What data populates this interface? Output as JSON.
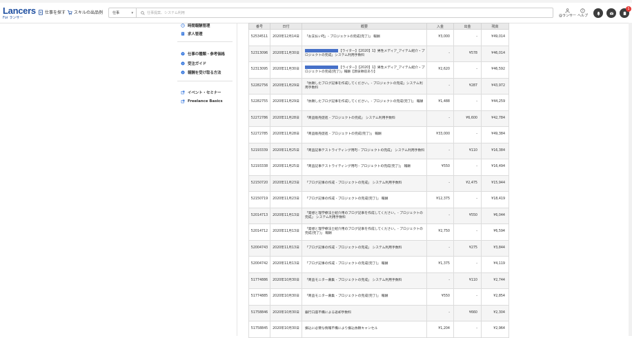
{
  "header": {
    "logo": "Lancers",
    "logo_sub": "For ランサー",
    "nav_find_jobs": "仕事を探す",
    "nav_skill_listing": "スキルの出品例",
    "category_select": "仕事",
    "search_placeholder": "仕事提案、システム利用",
    "menu_lancer": "@ランサー",
    "menu_help": "ヘルプ",
    "notification_badge": "1"
  },
  "sidebar": {
    "items": [
      {
        "label": "時間報酬管理"
      },
      {
        "label": "求人管理"
      },
      {
        "label": "仕事の種類・参考価格"
      },
      {
        "label": "受注ガイド"
      },
      {
        "label": "報酬を受け取る方法"
      },
      {
        "label": "イベント・セミナー"
      },
      {
        "label": "Freelance Basics"
      }
    ]
  },
  "table": {
    "headers": [
      "番号",
      "日付",
      "概要",
      "入金",
      "出金",
      "残高"
    ],
    "rows": [
      {
        "id": "52534511",
        "date": "2020年12月14日",
        "desc": "「お支払いPJ」- プロジェクトの完成(完了)」 報酬",
        "in": "¥3,000",
        "out": "-",
        "bal": "¥49,014",
        "redact": false
      },
      {
        "id": "52313096",
        "date": "2020年11月30日",
        "desc": "【ライター】【2020】1】男性メディア_アイテム紹介・プロジェクトの完成」システム利用手数料",
        "in": "-",
        "out": "¥578",
        "bal": "¥46,014",
        "redact": true
      },
      {
        "id": "52313095",
        "date": "2020年11月30日",
        "desc": "【ライター】【2020】1】男性メディア_アイテム紹介・プロジェクトの完成(完了)」報酬【源泉徴収あり】",
        "in": "¥2,620",
        "out": "-",
        "bal": "¥46,592",
        "redact": true
      },
      {
        "id": "52282756",
        "date": "2020年11月29日",
        "desc": "「依頼したブログ記事を作成してください。- プロジェクトの完成」システム利用手数料",
        "in": "-",
        "out": "¥287",
        "bal": "¥43,972",
        "redact": false
      },
      {
        "id": "52282755",
        "date": "2020年11月29日",
        "desc": "「依頼したブログ記事を作成してください。- プロジェクトの完成(完了)」 報酬",
        "in": "¥1,488",
        "out": "-",
        "bal": "¥44,259",
        "redact": false
      },
      {
        "id": "52272786",
        "date": "2020年11月28日",
        "desc": "「商品販売促進 - プロジェクトの完成」 システム利用手数料",
        "in": "-",
        "out": "¥6,600",
        "bal": "¥42,784",
        "redact": false
      },
      {
        "id": "52272785",
        "date": "2020年11月28日",
        "desc": "「商品販売促進 - プロジェクトの完成(完了)」 報酬",
        "in": "¥33,000",
        "out": "-",
        "bal": "¥49,384",
        "redact": false
      },
      {
        "id": "52193339",
        "date": "2020年11月25日",
        "desc": "「商品記事テストライティング用PJ - プロジェクトの完成」 システム利用手数料",
        "in": "-",
        "out": "¥110",
        "bal": "¥16,384",
        "redact": false
      },
      {
        "id": "52193338",
        "date": "2020年11月25日",
        "desc": "「商品記事テストライティング用PJ - プロジェクトの完成(完了)」 報酬",
        "in": "¥550",
        "out": "-",
        "bal": "¥16,494",
        "redact": false
      },
      {
        "id": "52150720",
        "date": "2020年11月23日",
        "desc": "「ブログ記事の作成 - プロジェクトの完成」 システム利用手数料",
        "in": "-",
        "out": "¥2,475",
        "bal": "¥15,944",
        "redact": false
      },
      {
        "id": "52150719",
        "date": "2020年11月23日",
        "desc": "「ブログ記事の作成 - プロジェクトの完成(完了)」 報酬",
        "in": "¥12,375",
        "out": "-",
        "bal": "¥18,419",
        "redact": false
      },
      {
        "id": "52014713",
        "date": "2020年11月13日",
        "desc": "「発想と理学療法士紹介用のブログ記事を作成してください。- プロジェクトの完成」 システム利用手数料",
        "in": "-",
        "out": "¥550",
        "bal": "¥6,044",
        "redact": false
      },
      {
        "id": "52014712",
        "date": "2020年11月13日",
        "desc": "「発想と理学療法士紹介用のブログ記事を作成してください。- プロジェクトの完成(完了)」 報酬",
        "in": "¥2,750",
        "out": "-",
        "bal": "¥6,594",
        "redact": false
      },
      {
        "id": "52004743",
        "date": "2020年11月13日",
        "desc": "「ブログ記事の作成 - プロジェクトの完成」 システム利用手数料",
        "in": "-",
        "out": "¥275",
        "bal": "¥3,844",
        "redact": false
      },
      {
        "id": "52004742",
        "date": "2020年11月13日",
        "desc": "「ブログ記事の作成 - プロジェクトの完成(完了)」 報酬",
        "in": "¥1,375",
        "out": "-",
        "bal": "¥4,119",
        "redact": false
      },
      {
        "id": "51774886",
        "date": "2020年10月30日",
        "desc": "「商品モニター募集 - プロジェクトの完成」 システム利用手数料",
        "in": "-",
        "out": "¥110",
        "bal": "¥2,744",
        "redact": false
      },
      {
        "id": "51774885",
        "date": "2020年10月30日",
        "desc": "「商品モニター募集 - プロジェクトの完成(完了)」 報酬",
        "in": "¥550",
        "out": "-",
        "bal": "¥2,854",
        "redact": false
      },
      {
        "id": "51758846",
        "date": "2020年10月30日",
        "desc": "銀行口座不備による返却手数料",
        "in": "-",
        "out": "¥660",
        "bal": "¥2,304",
        "redact": false
      },
      {
        "id": "51758845",
        "date": "2020年10月30日",
        "desc": "振込に必要な情報不備により振込依頼キャンセル",
        "in": "¥1,204",
        "out": "-",
        "bal": "¥2,964",
        "redact": false
      }
    ]
  },
  "colors": {
    "brand": "#1d4ea0",
    "redaction": "#4670c8",
    "badge": "#e53935"
  }
}
